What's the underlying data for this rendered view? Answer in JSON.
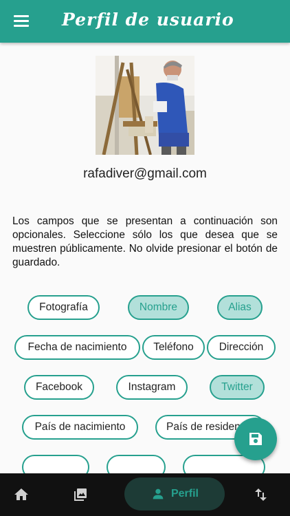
{
  "app_bar": {
    "title": "Perfil de usuario",
    "menu_icon": "menu-icon",
    "color": "#26a08e"
  },
  "profile": {
    "avatar": "user-photo",
    "email": "rafadiver@gmail.com"
  },
  "description": "Los campos que se presentan a continuación son opcionales. Seleccione sólo los que desea que se muestren públicamente. No olvide presionar el botón de guardado.",
  "chips": [
    {
      "label": "Fotografía",
      "selected": false
    },
    {
      "label": "Nombre",
      "selected": true
    },
    {
      "label": "Alias",
      "selected": true
    },
    {
      "label": "Fecha de nacimiento",
      "selected": false
    },
    {
      "label": "Teléfono",
      "selected": false
    },
    {
      "label": "Dirección",
      "selected": false
    },
    {
      "label": "Facebook",
      "selected": false
    },
    {
      "label": "Instagram",
      "selected": false
    },
    {
      "label": "Twitter",
      "selected": true
    },
    {
      "label": "País de nacimiento",
      "selected": false
    },
    {
      "label": "País de residencia",
      "selected": false
    }
  ],
  "fab": {
    "icon": "save-icon"
  },
  "bottom_nav": {
    "items": [
      {
        "icon": "home-icon"
      },
      {
        "icon": "gallery-icon"
      },
      {
        "icon": "person-icon",
        "label": "Perfil",
        "active": true
      },
      {
        "icon": "sort-arrows-icon"
      }
    ]
  },
  "colors": {
    "accent": "#26a08e",
    "chip_selected_bg": "#b2e0da",
    "nav_bg": "#111111"
  }
}
